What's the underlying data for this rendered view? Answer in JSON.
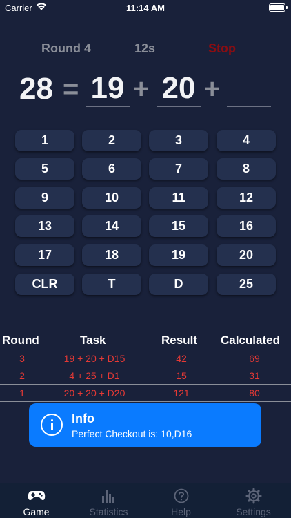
{
  "status_bar": {
    "carrier": "Carrier",
    "time": "11:14 AM"
  },
  "game": {
    "round_label": "Round 4",
    "timer": "12s",
    "stop_label": "Stop",
    "stop_color": "#8a0d12"
  },
  "equation": {
    "target": "28",
    "equals": "=",
    "plus": "+",
    "dart1": "19",
    "dart2": "20",
    "dart3": ""
  },
  "keypad": {
    "keys": [
      "1",
      "2",
      "3",
      "4",
      "5",
      "6",
      "7",
      "8",
      "9",
      "10",
      "11",
      "12",
      "13",
      "14",
      "15",
      "16",
      "17",
      "18",
      "19",
      "20",
      "CLR",
      "T",
      "D",
      "25"
    ]
  },
  "history": {
    "headers": {
      "round": "Round",
      "task": "Task",
      "result": "Result",
      "calculated": "Calculated"
    },
    "rows": [
      {
        "round": "3",
        "task": "19 + 20 + D15",
        "result": "42",
        "calculated": "69"
      },
      {
        "round": "2",
        "task": "4 + 25 + D1",
        "result": "15",
        "calculated": "31"
      },
      {
        "round": "1",
        "task": "20 + 20 + D20",
        "result": "121",
        "calculated": "80"
      }
    ],
    "row_color": "#e53935"
  },
  "toast": {
    "title": "Info",
    "message": "Perfect Checkout is: 10,D16",
    "icon": "info-icon",
    "color": "#0a7bff"
  },
  "tabbar": {
    "tabs": [
      {
        "label": "Game",
        "icon": "gamepad-icon",
        "active": true
      },
      {
        "label": "Statistics",
        "icon": "bar-chart-icon",
        "active": false
      },
      {
        "label": "Help",
        "icon": "question-circle-icon",
        "active": false
      },
      {
        "label": "Settings",
        "icon": "gear-icon",
        "active": false
      }
    ]
  },
  "colors": {
    "background": "#19213a",
    "key": "#24304e",
    "tabbar": "#132036"
  }
}
